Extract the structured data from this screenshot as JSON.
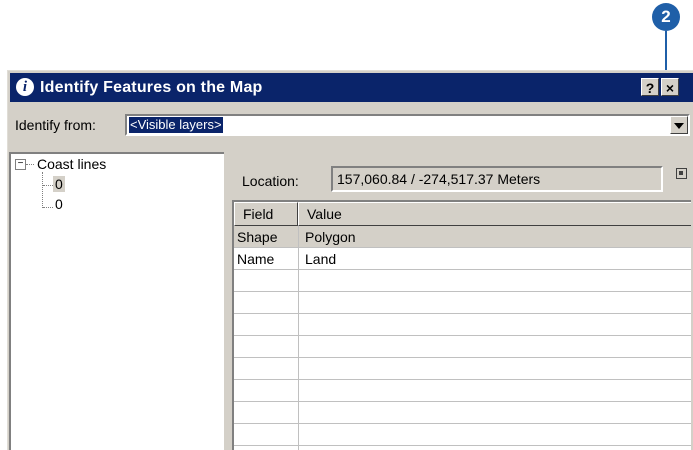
{
  "callout": {
    "number": "2",
    "color": "#1f5fa8"
  },
  "window": {
    "title": "Identify Features on the Map",
    "title_icon": "info-icon",
    "help_label": "?",
    "close_label": "×"
  },
  "identify_from": {
    "label": "Identify from:",
    "selected": "<Visible layers>"
  },
  "tree": {
    "expander": "−",
    "root": "Coast lines",
    "children": [
      "0",
      "0"
    ]
  },
  "location": {
    "label": "Location:",
    "value": "157,060.84 / -274,517.37 Meters"
  },
  "grid": {
    "headers": [
      "Field",
      "Value"
    ],
    "rows": [
      {
        "field": "Shape",
        "value": "Polygon"
      },
      {
        "field": "Name",
        "value": "Land"
      }
    ]
  },
  "colors": {
    "titlebar": "#0a246a",
    "face": "#d4d0c8",
    "selection": "#0a246a"
  }
}
